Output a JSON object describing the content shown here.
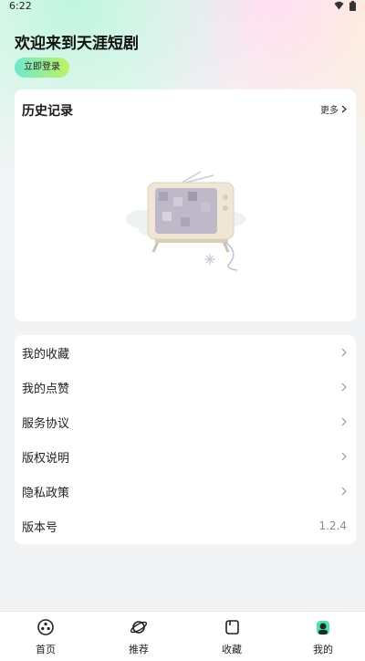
{
  "status_bar": {
    "time": "6:22"
  },
  "header": {
    "welcome": "欢迎来到天涯短剧",
    "login_label": "立即登录"
  },
  "history": {
    "title": "历史记录",
    "more_label": "更多"
  },
  "menu": {
    "items": [
      {
        "label": "我的收藏"
      },
      {
        "label": "我的点赞"
      },
      {
        "label": "服务协议"
      },
      {
        "label": "版权说明"
      },
      {
        "label": "隐私政策"
      }
    ],
    "version_label": "版本号",
    "version_value": "1.2.4"
  },
  "bottom_nav": {
    "tabs": [
      {
        "label": "首页",
        "icon": "film-reel-icon"
      },
      {
        "label": "推荐",
        "icon": "planet-icon"
      },
      {
        "label": "收藏",
        "icon": "bookmark-icon"
      },
      {
        "label": "我的",
        "icon": "profile-icon"
      }
    ]
  },
  "colors": {
    "login_gradient_start": "#6ee8cd",
    "login_gradient_end": "#bff266",
    "active_tab_accent": "#4fe0b8"
  }
}
